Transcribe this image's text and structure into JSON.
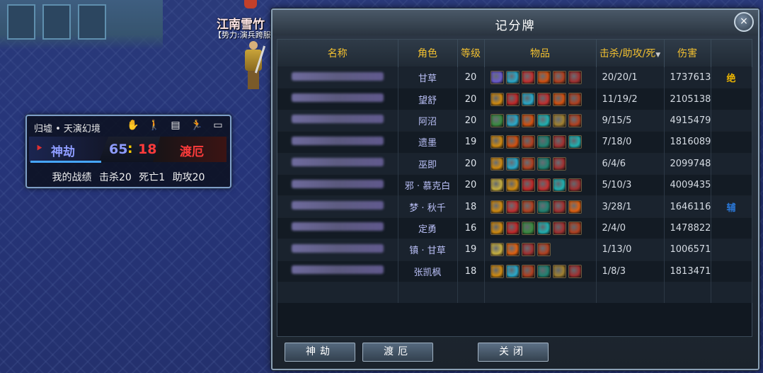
{
  "scene": {
    "player_name": "江南雪竹",
    "player_tag": "【势力:演兵跨服"
  },
  "battle_panel": {
    "location": "归墟 • 天演幻境",
    "icons": [
      "hand-icon",
      "person-icon",
      "document-icon",
      "running-icon",
      "minimize-icon"
    ],
    "team_a": "神劫",
    "team_b": "渡厄",
    "score_a": "65",
    "score_sep": ":",
    "score_b": "18",
    "stats_label": "我的战绩",
    "kills": "击杀20",
    "deaths": "死亡1",
    "assists": "助攻20"
  },
  "board": {
    "title": "记分牌",
    "close_icon": "×",
    "headers": {
      "name": "名称",
      "role": "角色",
      "level": "等级",
      "items": "物品",
      "kda": "击杀/助攻/死",
      "damage": "伤害"
    },
    "rows": [
      {
        "role": "甘草",
        "level": "20",
        "kda": "20/20/1",
        "damage": "1737613",
        "mark": "绝",
        "mark_color": "#f0b800",
        "items": [
          "#6a5acd",
          "#2aa8c8",
          "#c03030",
          "#d05010",
          "#b04020",
          "#a03030"
        ]
      },
      {
        "role": "望舒",
        "level": "20",
        "kda": "11/19/2",
        "damage": "2105138",
        "mark": "",
        "mark_color": "",
        "items": [
          "#d08a10",
          "#c02828",
          "#2aa8c8",
          "#c03030",
          "#d05010",
          "#b04020"
        ]
      },
      {
        "role": "阿沼",
        "level": "20",
        "kda": "9/15/5",
        "damage": "4915479",
        "mark": "",
        "mark_color": "",
        "items": [
          "#3a8a40",
          "#2aa8c8",
          "#d05010",
          "#20b0b0",
          "#a08030",
          "#b04020"
        ]
      },
      {
        "role": "遗墨",
        "level": "19",
        "kda": "7/18/0",
        "damage": "1816089",
        "mark": "",
        "mark_color": "",
        "items": [
          "#d08a10",
          "#d05010",
          "#b04020",
          "#208070",
          "#a03030",
          "#20b0b0"
        ]
      },
      {
        "role": "巫即",
        "level": "20",
        "kda": "6/4/6",
        "damage": "2099748",
        "mark": "",
        "mark_color": "",
        "items": [
          "#d08a10",
          "#2aa8c8",
          "#b04020",
          "#208070",
          "#a03030"
        ]
      },
      {
        "role": "邪 · 慕克白",
        "level": "20",
        "kda": "5/10/3",
        "damage": "4009435",
        "mark": "",
        "mark_color": "",
        "items": [
          "#c8b040",
          "#d08a10",
          "#c02828",
          "#c03030",
          "#20b0b0",
          "#a03030"
        ]
      },
      {
        "role": "梦 · 秋千",
        "level": "18",
        "kda": "3/28/1",
        "damage": "1646116",
        "mark": "辅",
        "mark_color": "#2a78d8",
        "items": [
          "#d08a10",
          "#c03030",
          "#b04020",
          "#208070",
          "#a03030",
          "#e06010"
        ]
      },
      {
        "role": "定勇",
        "level": "16",
        "kda": "2/4/0",
        "damage": "1478822",
        "mark": "",
        "mark_color": "",
        "items": [
          "#d08a10",
          "#c02828",
          "#3a8a40",
          "#20b0b0",
          "#a03030",
          "#b04020"
        ]
      },
      {
        "role": "镇 · 甘草",
        "level": "19",
        "kda": "1/13/0",
        "damage": "1006571",
        "mark": "",
        "mark_color": "",
        "items": [
          "#c8b040",
          "#e06010",
          "#a03030",
          "#b04020"
        ]
      },
      {
        "role": "张凯枫",
        "level": "18",
        "kda": "1/8/3",
        "damage": "1813471",
        "mark": "",
        "mark_color": "",
        "items": [
          "#d08a10",
          "#2aa8c8",
          "#b04020",
          "#208070",
          "#a08030",
          "#a03030"
        ]
      }
    ],
    "tab_a": "神劫",
    "tab_b": "渡厄",
    "close_label": "关闭"
  }
}
